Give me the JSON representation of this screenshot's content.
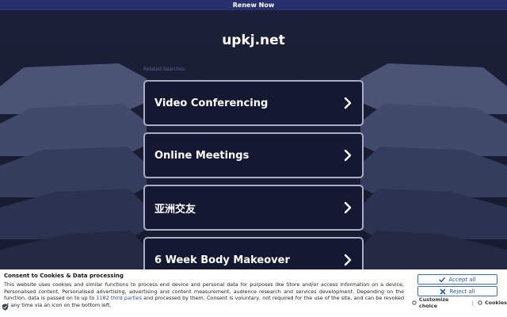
{
  "topbar": {
    "renew_label": "Renew Now"
  },
  "header": {
    "domain": "upkj.net"
  },
  "related": {
    "label": "Related Searches:",
    "items": [
      {
        "label": "Video Conferencing"
      },
      {
        "label": "Online Meetings"
      },
      {
        "label": "亚洲交友"
      },
      {
        "label": "6 Week Body Makeover"
      }
    ]
  },
  "consent": {
    "title": "Consent to Cookies & Data processing",
    "text_before_link": "This website uses cookies and similar functions to process end device and personal data for purposes like Store and/or access information on a device, Personalised content, Personalised advertising, advertising and content measurement, audience research and services development. Depending on the function, data is passed on to up to ",
    "link_text": "1182 third parties",
    "text_after_link": " and processed by them. Consent is voluntary, not required for the use of the site, and can be revoked at any time via an icon on the bottom left.",
    "accept_label": "Accept all",
    "reject_label": "Reject all",
    "customize_label": "Customize choice",
    "separator": "|",
    "cookies_label": "Cookies"
  },
  "colors": {
    "background": "#181c33",
    "topbar": "#28306e",
    "card_border": "#a9adc6",
    "accent_blue": "#3f6dc6"
  },
  "icons": {
    "card_arrow": "chevron-right-icon",
    "accept": "checkmark-icon",
    "reject": "x-icon",
    "customize": "gear-icon",
    "cookies": "gear-icon",
    "consent_shield": "shield-icon"
  }
}
